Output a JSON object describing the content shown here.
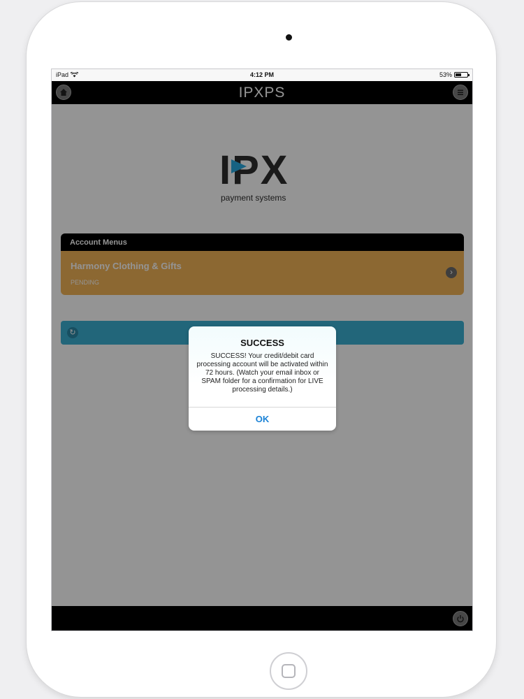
{
  "status_bar": {
    "device": "iPad",
    "time": "4:12 PM",
    "battery": "53%"
  },
  "header": {
    "title": "IPXPS"
  },
  "logo": {
    "brand": "IPX",
    "tagline": "payment systems"
  },
  "account_panel": {
    "header": "Account Menus",
    "items": [
      {
        "name": "Harmony Clothing & Gifts",
        "status": "PENDING"
      }
    ]
  },
  "alert": {
    "title": "SUCCESS",
    "message": "SUCCESS!  Your credit/debit card processing account will be activated within 72 hours.  (Watch your email inbox or SPAM folder for a confirmation for LIVE processing details.)",
    "ok_label": "OK"
  },
  "colors": {
    "header_bg": "#000000",
    "item_bg": "#f2b356",
    "action_bar": "#3bb0d3",
    "link_blue": "#1a82d6",
    "logo_accent": "#29a9e0"
  },
  "icons": [
    "wifi-icon",
    "battery-icon",
    "home-icon",
    "menu-icon",
    "chevron-right-icon",
    "refresh-icon",
    "power-icon"
  ]
}
